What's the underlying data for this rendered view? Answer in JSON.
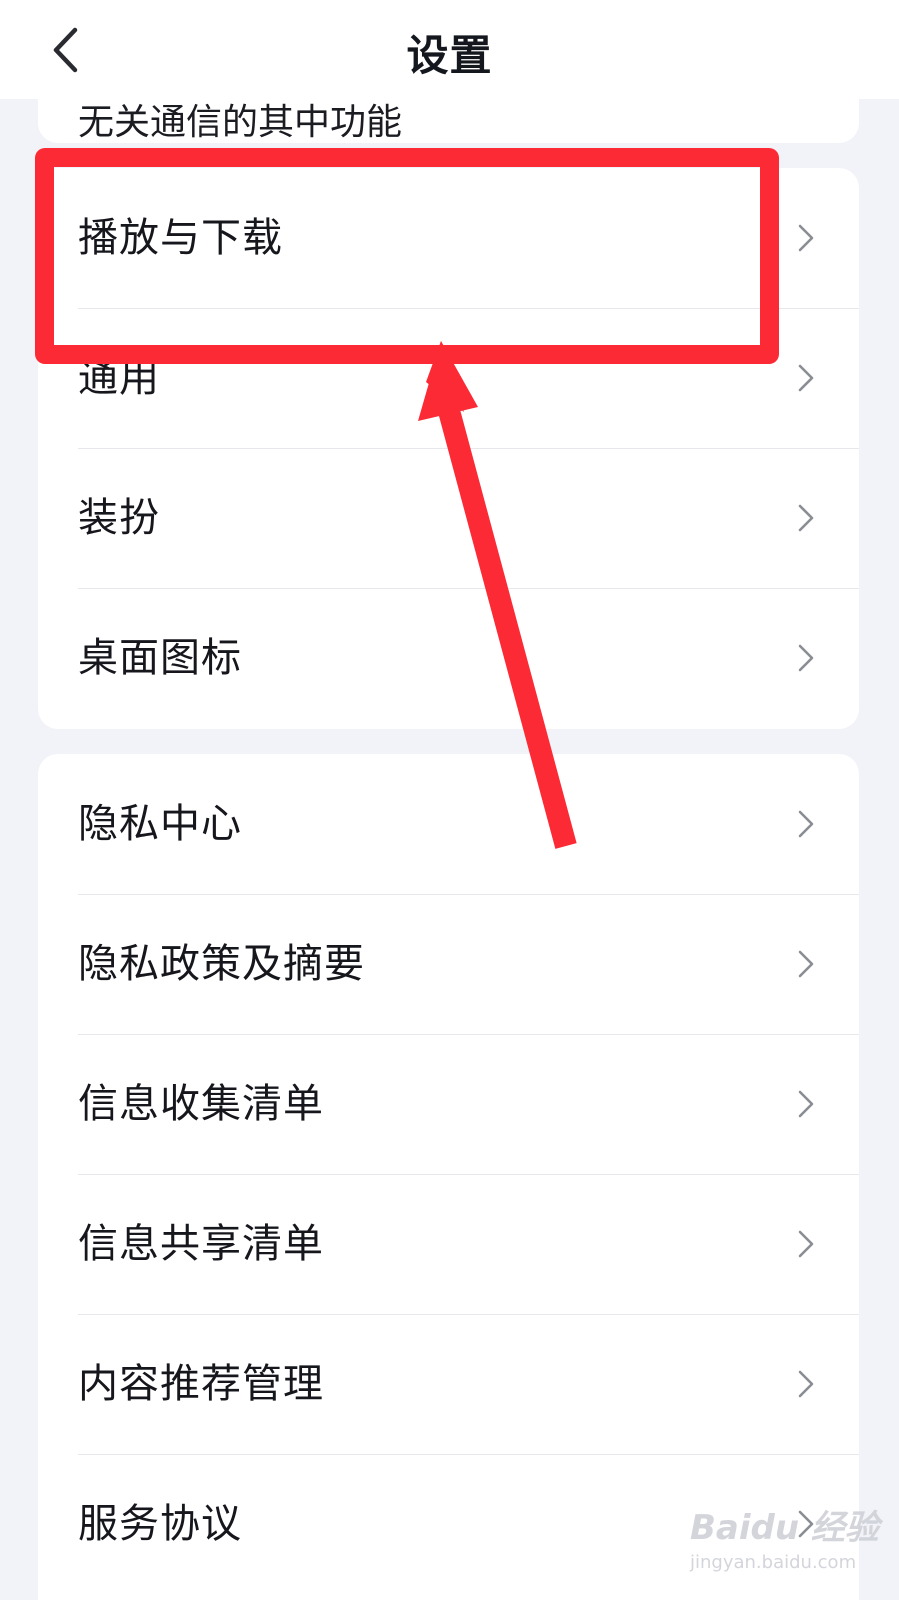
{
  "header": {
    "title": "设置",
    "back_icon": "chevron-left-icon"
  },
  "top_card": {
    "clipped_text": "无关通信的其中功能"
  },
  "group1": {
    "items": [
      {
        "label": "播放与下载"
      },
      {
        "label": "通用"
      },
      {
        "label": "装扮"
      },
      {
        "label": "桌面图标"
      }
    ]
  },
  "group2": {
    "items": [
      {
        "label": "隐私中心"
      },
      {
        "label": "隐私政策及摘要"
      },
      {
        "label": "信息收集清单"
      },
      {
        "label": "信息共享清单"
      },
      {
        "label": "内容推荐管理"
      },
      {
        "label": "服务协议"
      }
    ]
  },
  "annotation": {
    "color": "#fb2a35",
    "highlighted_item": "播放与下载"
  },
  "watermark": {
    "logo": "Baidu 经验",
    "site": "jingyan.baidu.com"
  }
}
